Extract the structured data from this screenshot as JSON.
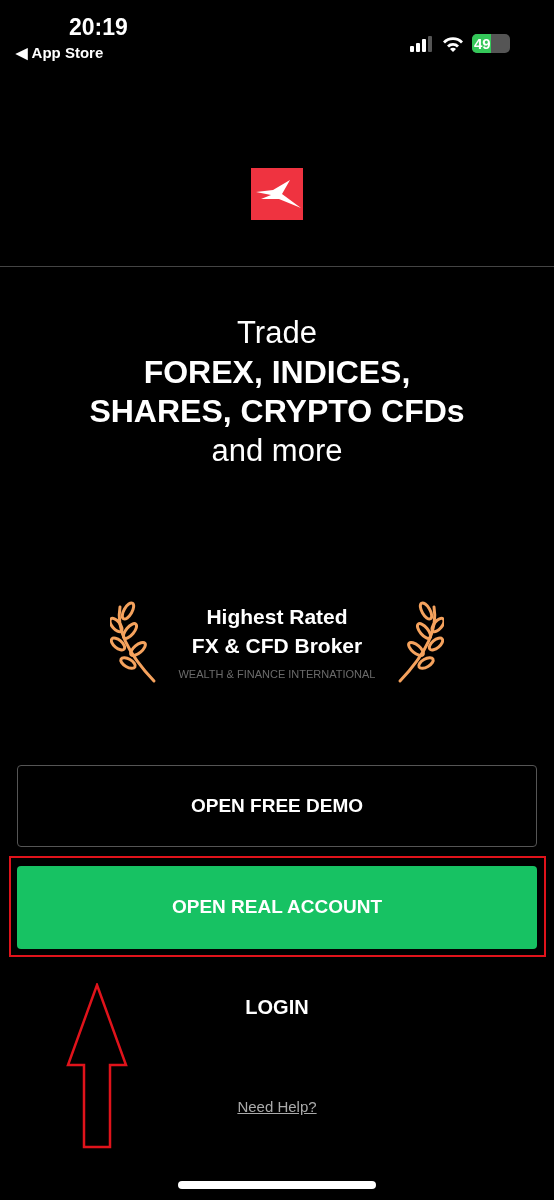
{
  "status_bar": {
    "time": "20:19",
    "back_label": "◀ App Store",
    "battery": "49"
  },
  "headline": [
    {
      "text": "Trade",
      "kind": "regular"
    },
    {
      "text": "FOREX, INDICES,",
      "kind": "bold"
    },
    {
      "text": "SHARES, CRYPTO CFDs",
      "kind": "bold"
    },
    {
      "text": "and more",
      "kind": "regular"
    }
  ],
  "award": {
    "title": [
      "Highest Rated",
      "FX & CFD Broker"
    ],
    "source": "WEALTH & FINANCE INTERNATIONAL"
  },
  "actions": [
    {
      "label": "OPEN FREE DEMO",
      "kind": "outline"
    },
    {
      "label": "OPEN REAL ACCOUNT",
      "kind": "primary"
    },
    {
      "label": "LOGIN",
      "kind": "text"
    },
    {
      "label": "Need Help?",
      "kind": "link"
    }
  ]
}
